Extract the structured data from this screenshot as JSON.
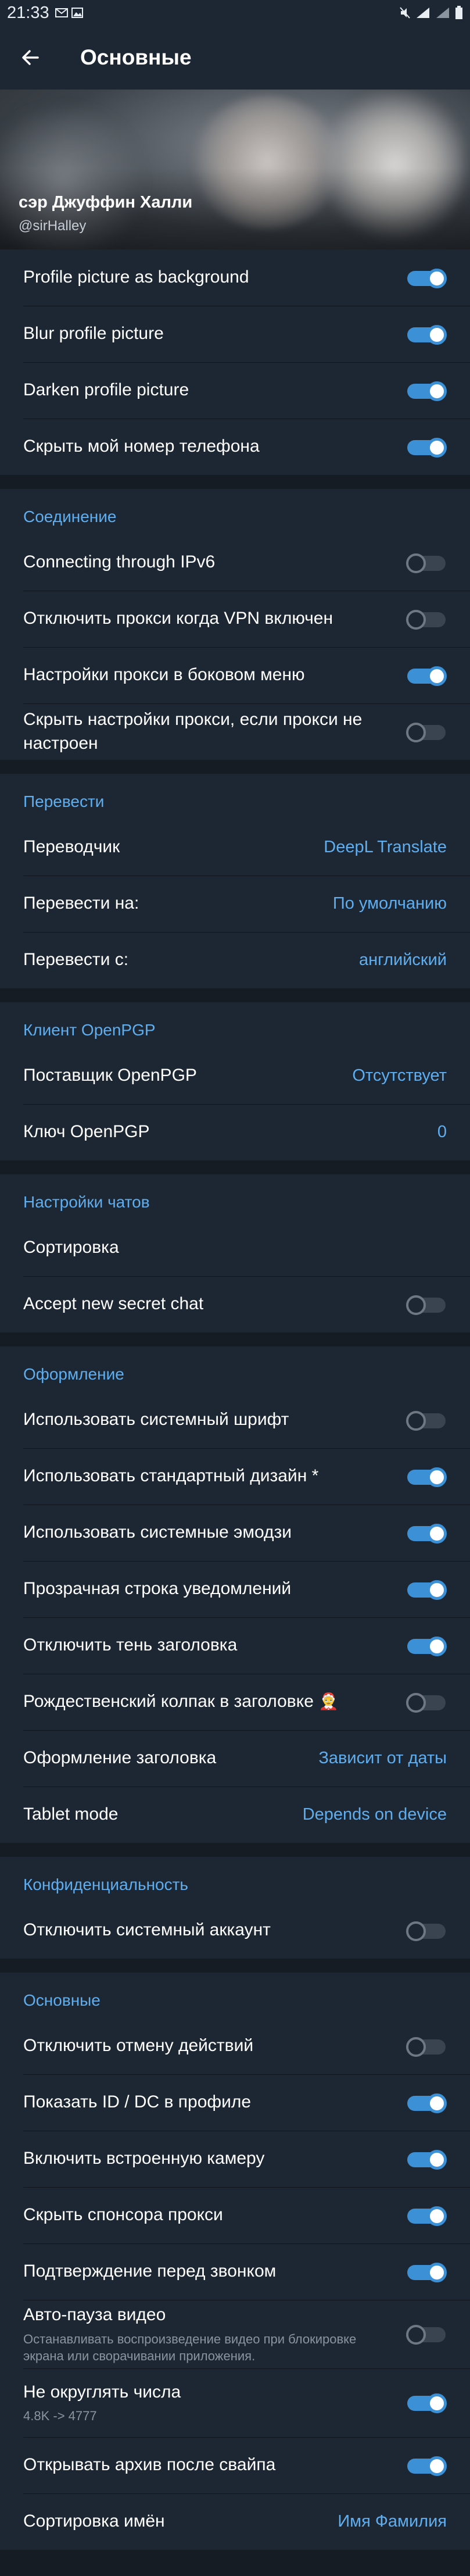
{
  "status": {
    "time": "21:33"
  },
  "appbar": {
    "title": "Основные"
  },
  "profile": {
    "name": "сэр Джуффин Халли",
    "username": "@sirHalley"
  },
  "colors": {
    "accent": "#5eaef0",
    "toggle_on": "#3b90d6",
    "row_bg": "#1d2733",
    "page_bg": "#151c24"
  },
  "sections": [
    {
      "header": "",
      "rows": [
        {
          "label": "Profile picture as background",
          "toggle": true
        },
        {
          "label": "Blur profile picture",
          "toggle": true
        },
        {
          "label": "Darken profile picture",
          "toggle": true
        },
        {
          "label": "Скрыть мой номер телефона",
          "toggle": true
        }
      ]
    },
    {
      "header": "Соединение",
      "rows": [
        {
          "label": "Connecting through IPv6",
          "toggle": false
        },
        {
          "label": "Отключить прокси когда VPN включен",
          "toggle": false
        },
        {
          "label": "Настройки прокси в боковом меню",
          "toggle": true
        },
        {
          "label": "Скрыть настройки прокси, если прокси не настроен",
          "toggle": false
        }
      ]
    },
    {
      "header": "Перевести",
      "rows": [
        {
          "label": "Переводчик",
          "value": "DeepL Translate"
        },
        {
          "label": "Перевести на:",
          "value": "По умолчанию"
        },
        {
          "label": "Перевести с:",
          "value": "английский"
        }
      ]
    },
    {
      "header": "Клиент OpenPGP",
      "rows": [
        {
          "label": "Поставщик OpenPGP",
          "value": "Отсутствует"
        },
        {
          "label": "Ключ OpenPGP",
          "value": "0"
        }
      ]
    },
    {
      "header": "Настройки чатов",
      "rows": [
        {
          "label": "Сортировка"
        },
        {
          "label": "Accept new secret chat",
          "toggle": false
        }
      ]
    },
    {
      "header": "Оформление",
      "rows": [
        {
          "label": "Использовать системный шрифт",
          "toggle": false
        },
        {
          "label": "Использовать стандартный дизайн *",
          "toggle": true
        },
        {
          "label": "Использовать системные эмодзи",
          "toggle": true
        },
        {
          "label": "Прозрачная строка уведомлений",
          "toggle": true
        },
        {
          "label": "Отключить тень заголовка",
          "toggle": true
        },
        {
          "label": "Рождественский колпак в заголовке",
          "emoji": "🤶",
          "toggle": false
        },
        {
          "label": "Оформление заголовка",
          "value": "Зависит от даты"
        },
        {
          "label": "Tablet mode",
          "value": "Depends on device"
        }
      ]
    },
    {
      "header": "Конфиденциальность",
      "rows": [
        {
          "label": "Отключить системный аккаунт",
          "toggle": false
        }
      ]
    },
    {
      "header": "Основные",
      "rows": [
        {
          "label": "Отключить отмену действий",
          "toggle": false
        },
        {
          "label": "Показать ID / DC в профиле",
          "toggle": true
        },
        {
          "label": "Включить встроенную камеру",
          "toggle": true
        },
        {
          "label": "Скрыть спонсора прокси",
          "toggle": true
        },
        {
          "label": "Подтверждение перед звонком",
          "toggle": true
        },
        {
          "label": "Авто-пауза видео",
          "sub": "Останавливать воспроизведение видео при блокировке экрана или сворачивании приложения.",
          "toggle": false
        },
        {
          "label": "Не округлять числа",
          "sub": "4.8K -> 4777",
          "toggle": true
        },
        {
          "label": "Открывать архив после свайпа",
          "toggle": true
        },
        {
          "label": "Сортировка имён",
          "value": "Имя Фамилия"
        }
      ]
    }
  ]
}
